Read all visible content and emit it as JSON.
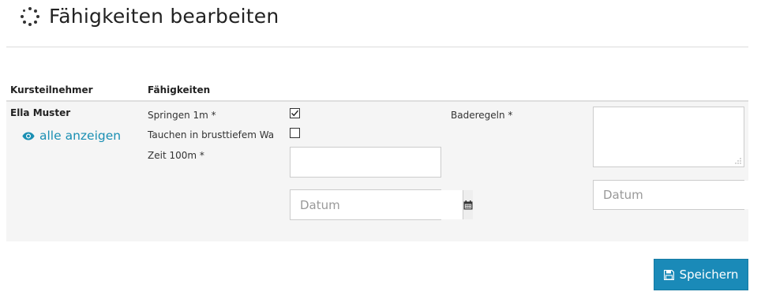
{
  "page": {
    "title": "Fähigkeiten bearbeiten",
    "icon": "spinner-icon"
  },
  "table": {
    "headers": {
      "participant": "Kursteilnehmer",
      "skills": "Fähigkeiten"
    },
    "row": {
      "participant_name": "Ella Muster",
      "show_all_label": "alle anzeigen",
      "show_all_icon": "eye-icon",
      "skills": [
        {
          "label": "Springen 1m *",
          "type": "checkbox",
          "checked": true
        },
        {
          "label": "Tauchen in brusttiefem Wasser *",
          "type": "checkbox",
          "checked": false
        },
        {
          "label": "Zeit 100m *",
          "type": "text",
          "value": ""
        }
      ],
      "zeit_date_placeholder": "Datum",
      "baderegeln": {
        "label": "Baderegeln *",
        "value": "",
        "date_placeholder": "Datum"
      }
    }
  },
  "actions": {
    "save_label": "Speichern",
    "save_icon": "floppy-disk-icon"
  },
  "colors": {
    "accent": "#1a8ab8",
    "link": "#1a8fb3",
    "row_background": "#f5f5f5"
  }
}
